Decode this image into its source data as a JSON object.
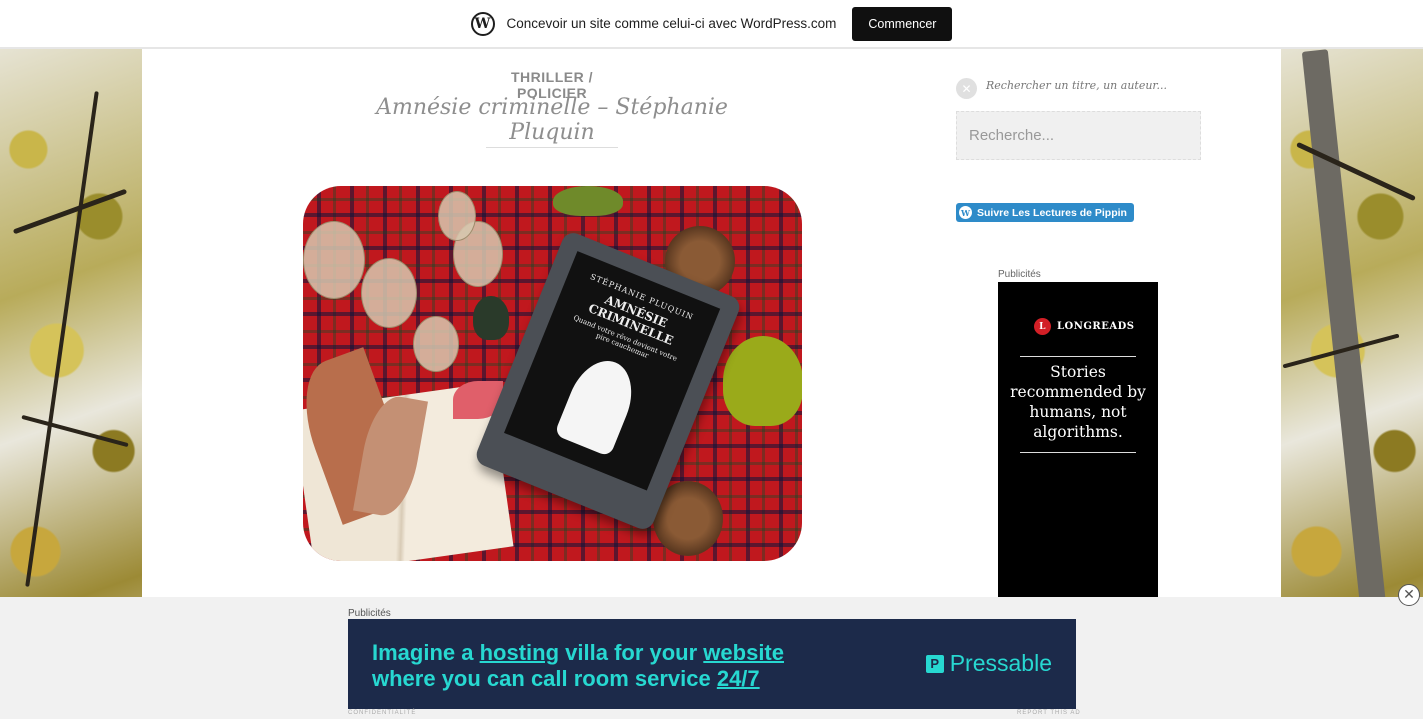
{
  "wp_bar": {
    "logo_glyph": "W",
    "text": "Concevoir un site comme celui-ci avec WordPress.com",
    "button_label": "Commencer"
  },
  "post": {
    "category": "THRILLER / POLICIER",
    "title": "Amnésie criminelle – Stéphanie Pluquin",
    "image_alt": "Amnésie criminelle",
    "ebook": {
      "author": "STÉPHANIE PLUQUIN",
      "title": "AMNÉSIE CRIMINELLE",
      "tagline": "Quand votre rêve devient votre pire cauchemar"
    }
  },
  "sidebar": {
    "search_label": "Rechercher un titre, un auteur...",
    "search_placeholder": "Recherche...",
    "follow_button": "Suivre Les Lectures de Pippin",
    "ad_label": "Publicités",
    "ad": {
      "brand": "LONGREADS",
      "brand_glyph": "L",
      "text": "Stories recommended by humans, not algorithms."
    }
  },
  "bottom_ad": {
    "label": "Publicités",
    "line1_a": "Imagine a ",
    "line1_b": "hosting",
    "line1_c": " villa for your ",
    "line1_d": "website",
    "line2_a": "where you can call room service ",
    "line2_b": "24/7",
    "brand": "Pressable",
    "brand_glyph": "P",
    "privacy": "CONFIDENTIALITÉ",
    "report": "REPORT THIS AD"
  },
  "colors": {
    "wp_button": "#101010",
    "follow_button": "#2e8bc9",
    "ad_bg": "#1c2a4a",
    "ad_accent": "#27d8d1"
  },
  "icons": {
    "wp": "wordpress-icon",
    "search": "search-icon",
    "close": "close-icon"
  }
}
